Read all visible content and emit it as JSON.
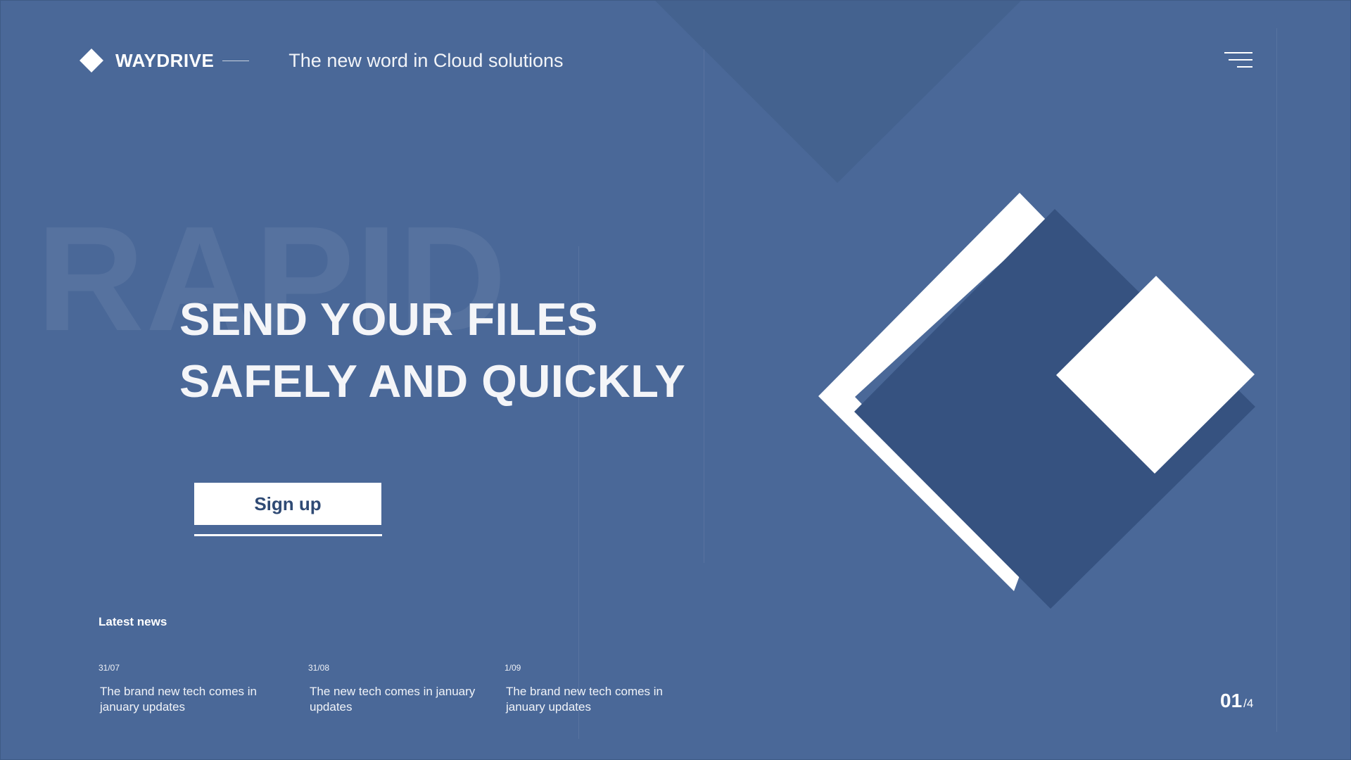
{
  "brand": {
    "name": "WAYDRIVE",
    "tagline": "The new word in Cloud solutions"
  },
  "header": {
    "menu_icon": "hamburger-menu-icon"
  },
  "hero": {
    "watermark": "RAPID",
    "title_line1": "SEND YOUR FILES",
    "title_line2": "SAFELY AND QUICKLY",
    "cta_label": "Sign up"
  },
  "news": {
    "heading": "Latest news",
    "items": [
      {
        "date": "31/07",
        "text": "The brand new tech comes in january updates"
      },
      {
        "date": "31/08",
        "text": "The new tech comes in january updates"
      },
      {
        "date": "1/09",
        "text": "The brand new tech comes in january updates"
      }
    ]
  },
  "pagination": {
    "current": "01",
    "total": "/4"
  },
  "colors": {
    "background": "#4a6898",
    "dark_shape": "#365280",
    "triangle": "#44628f",
    "white": "#ffffff",
    "button_text": "#2f4a74"
  }
}
